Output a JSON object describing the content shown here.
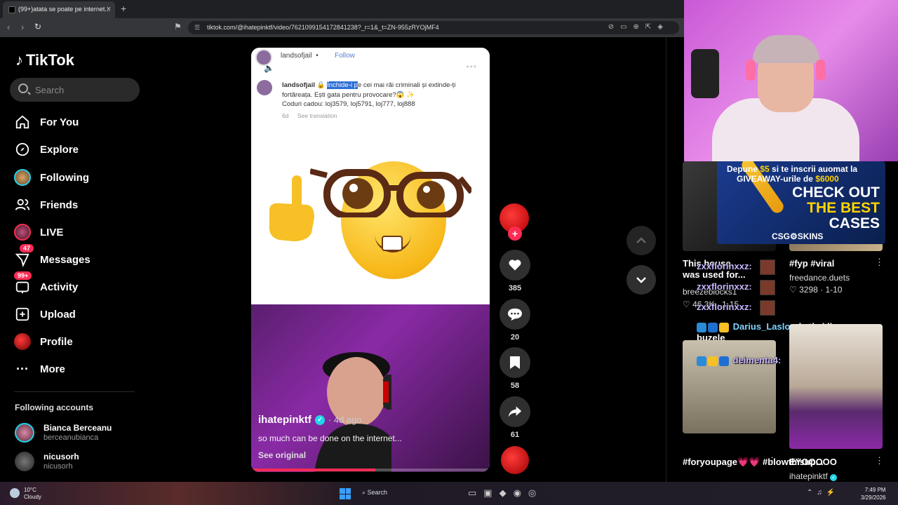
{
  "browser": {
    "tab_title": "(99+)atata se poate pe internet...",
    "tab_close": "×",
    "new_tab": "+",
    "url": "tiktok.com/@ihatepinktf/video/7621099154172841238?_r=1&_t=ZN-955zRYOjMF4"
  },
  "sidebar": {
    "brand": "TikTok",
    "search_placeholder": "Search",
    "items": [
      {
        "label": "For You",
        "icon": "home-icon"
      },
      {
        "label": "Explore",
        "icon": "compass-icon"
      },
      {
        "label": "Following",
        "icon": "avatar"
      },
      {
        "label": "Friends",
        "icon": "friends-icon"
      },
      {
        "label": "LIVE",
        "icon": "live-icon"
      },
      {
        "label": "Messages",
        "icon": "messages-icon",
        "badge": "47"
      },
      {
        "label": "Activity",
        "icon": "activity-icon",
        "badge": "99+"
      },
      {
        "label": "Upload",
        "icon": "upload-icon"
      },
      {
        "label": "Profile",
        "icon": "avatar"
      },
      {
        "label": "More",
        "icon": "more-icon"
      }
    ],
    "following_heading": "Following accounts",
    "following": [
      {
        "name": "Bianca Berceanu",
        "user": "berceanubianca"
      },
      {
        "name": "nicusorh",
        "user": "nicusorh"
      }
    ]
  },
  "video": {
    "inner_user": "landsofjail",
    "inner_follow": "Follow",
    "inner_dot": "•",
    "caption_user": "landsofjail",
    "caption_highlight": "Închide-i p",
    "caption_rest": "e cei mai răi criminali și extinde-ți fortăreața. Ești gata pentru provocare?😱 ✨",
    "caption_codes": "Coduri cadou: loj3579, loj5791, loj777, loj888",
    "caption_age": "6d",
    "see_translation": "See translation",
    "author": "ihatepinktf",
    "posted": "· 4d ago",
    "description": "so much can be done on the internet...",
    "see_original": "See original",
    "progress": 0.52
  },
  "actions": {
    "likes": "385",
    "comments": "20",
    "saves": "58",
    "shares": "61"
  },
  "stream": {
    "ad_line1_pre": "Depune ",
    "ad_line1_amt": "$5",
    "ad_line1_post": " si te inscrii auomat la",
    "ad_line2_pre": "GIVEAWAY-urile de ",
    "ad_line2_amt": "$6000",
    "ad_cta1": "CHECK OUT",
    "ad_cta2": "THE BEST",
    "ad_cta3": "CASES",
    "ad_brand": "CSG⚙SKINS",
    "cards": [
      {
        "title": "This house was used for...",
        "author": "breezeblocks1",
        "stats": "46.3K · 1-15"
      },
      {
        "title": "#fyp #viral",
        "author": "freedance.duets",
        "stats": "3298 · 1-10"
      },
      {
        "title": "#foryoupage💗💗 #blowthisup...",
        "author": "",
        "stats": ""
      },
      {
        "title": "EYOOOOO",
        "author": "ihatepinktf",
        "stats": ""
      }
    ],
    "chat": [
      {
        "user": "zxxflorinxxz:",
        "msg": ""
      },
      {
        "user": "zxxflorinxxz:",
        "msg": ""
      },
      {
        "user": "zxxflorinxxz:",
        "msg": ""
      },
      {
        "user": "Darius_Laslo:",
        "msg": "dc ti ai lins buzele"
      },
      {
        "user": "deimenta4:",
        "msg": ""
      }
    ]
  },
  "taskbar": {
    "temp": "10°C",
    "weather": "Cloudy",
    "search": "Search",
    "time": "7:49 PM",
    "date": "3/29/2026"
  },
  "colors": {
    "accent": "#fe2c55",
    "verified": "#20d5ec",
    "highlight": "#2c6fd6"
  }
}
